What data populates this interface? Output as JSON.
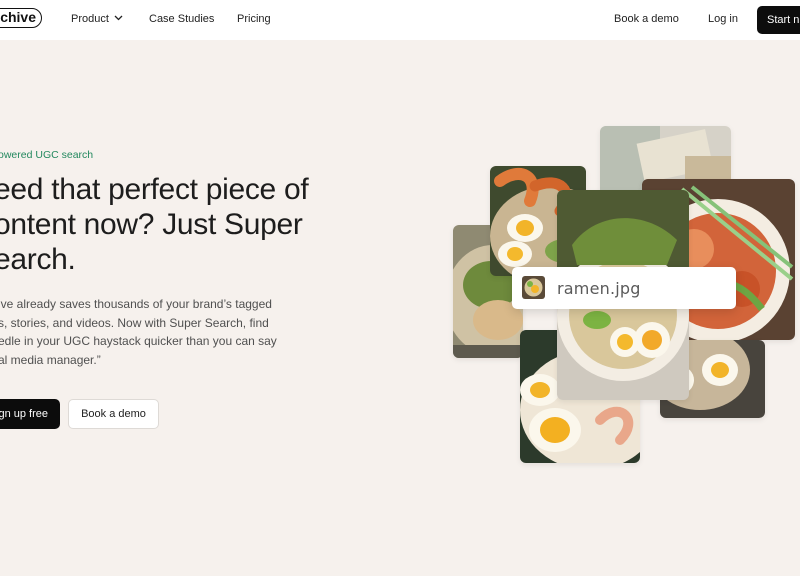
{
  "nav": {
    "logo": "chive",
    "product": "Product",
    "case_studies": "Case Studies",
    "pricing": "Pricing",
    "book_demo": "Book a demo",
    "login": "Log in",
    "start": "Start n"
  },
  "hero": {
    "eyebrow": "owered UGC search",
    "headline": [
      "eed that perfect piece of",
      "ontent now? Just Super",
      "earch."
    ],
    "description": [
      "ive already saves thousands of your brand’s tagged",
      "s, stories, and videos. Now with Super Search, find",
      "edle in your UGC haystack quicker than you can say",
      "al media manager.”"
    ],
    "signup": "gn up free",
    "demo": "Book a demo"
  },
  "collage": {
    "file_name": "ramen.jpg",
    "file_icon": "image-thumbnail-icon"
  },
  "colors": {
    "background": "#f6f1ed",
    "accent_green": "#23885e",
    "button_dark": "#0c0c0c"
  }
}
